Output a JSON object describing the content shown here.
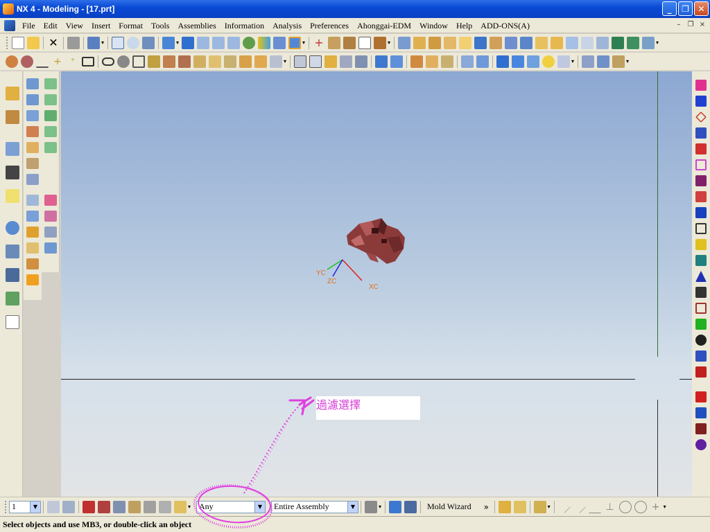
{
  "window": {
    "title": "NX 4 - Modeling - [17.prt]",
    "minimize": "_",
    "restore": "❐",
    "close": "✕"
  },
  "menu": {
    "items": [
      "File",
      "Edit",
      "View",
      "Insert",
      "Format",
      "Tools",
      "Assemblies",
      "Information",
      "Analysis",
      "Preferences",
      "Ahonggai-EDM",
      "Window",
      "Help",
      "ADD-ONS(A)"
    ],
    "doc_minimize": "–",
    "doc_restore": "❐",
    "doc_close": "×"
  },
  "viewport": {
    "axes": {
      "x_label": "XC",
      "y_label": "YC",
      "z_label": "ZC"
    },
    "annotation_text": "過濾選擇"
  },
  "selection_bar": {
    "layer_value": "1",
    "filter_value": "Any",
    "scope_value": "Entire Assembly",
    "app_label": "Mold Wizard",
    "more": "»"
  },
  "status": {
    "text": "Select objects and use MB3, or double-click an object"
  },
  "colors": {
    "title_bar": "#0a4ad6",
    "viewport_top": "#8ca7d2",
    "viewport_bottom": "#e2e4e6",
    "annotation": "#e040e0",
    "model": "#8b3a3a"
  }
}
